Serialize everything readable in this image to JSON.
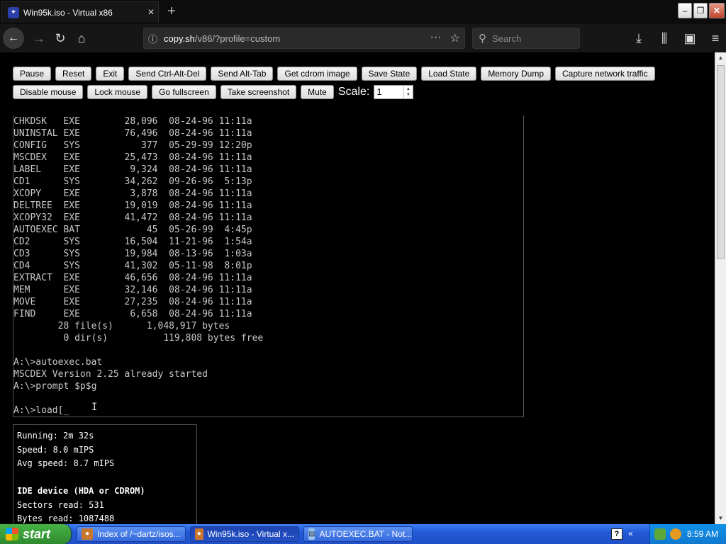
{
  "browser": {
    "tab_title": "Win95k.iso - Virtual x86",
    "tab_icon": "v86-icon",
    "url_host": "copy.sh",
    "url_path": "/v86/?profile=custom",
    "search_placeholder": "Search"
  },
  "toolbar": {
    "buttons": [
      "Pause",
      "Reset",
      "Exit",
      "Send Ctrl-Alt-Del",
      "Send Alt-Tab",
      "Get cdrom image",
      "Save State",
      "Load State",
      "Memory Dump",
      "Capture network traffic",
      "Disable mouse",
      "Lock mouse",
      "Go fullscreen",
      "Take screenshot",
      "Mute"
    ],
    "scale_label": "Scale:",
    "scale_value": "1"
  },
  "screen": {
    "lines": [
      "CHKDSK   EXE        28,096  08-24-96 11:11a",
      "UNINSTAL EXE        76,496  08-24-96 11:11a",
      "CONFIG   SYS           377  05-29-99 12:20p",
      "MSCDEX   EXE        25,473  08-24-96 11:11a",
      "LABEL    EXE         9,324  08-24-96 11:11a",
      "CD1      SYS        34,262  09-26-96  5:13p",
      "XCOPY    EXE         3,878  08-24-96 11:11a",
      "DELTREE  EXE        19,019  08-24-96 11:11a",
      "XCOPY32  EXE        41,472  08-24-96 11:11a",
      "AUTOEXEC BAT            45  05-26-99  4:45p",
      "CD2      SYS        16,504  11-21-96  1:54a",
      "CD3      SYS        19,984  08-13-96  1:03a",
      "CD4      SYS        41,302  05-11-98  8:01p",
      "EXTRACT  EXE        46,656  08-24-96 11:11a",
      "MEM      EXE        32,146  08-24-96 11:11a",
      "MOVE     EXE        27,235  08-24-96 11:11a",
      "FIND     EXE         6,658  08-24-96 11:11a",
      "        28 file(s)      1,048,917 bytes",
      "         0 dir(s)          119,808 bytes free",
      "",
      "A:\\>autoexec.bat",
      "MSCDEX Version 2.25 already started",
      "A:\\>prompt $p$g",
      "",
      "A:\\>load[_"
    ]
  },
  "stats": {
    "running": "Running: 2m 32s",
    "speed": "Speed: 8.0 mIPS",
    "avg_speed": "Avg speed: 8.7 mIPS",
    "ide_heading": "IDE device (HDA or CDROM)",
    "sectors_read": "Sectors read: 531",
    "bytes_read": "Bytes read: 1087488"
  },
  "taskbar": {
    "start_label": "start",
    "tasks": [
      "Index of /~dartz/isos...",
      "Win95k.iso - Virtual x...",
      "AUTOEXEC.BAT - Not..."
    ],
    "clock": "8:59 AM"
  },
  "colors": {
    "page_bg": "#000000",
    "taskbar_blue": "#2359d6",
    "start_green": "#2e8a2e",
    "tray_blue": "#0f7ad0"
  }
}
